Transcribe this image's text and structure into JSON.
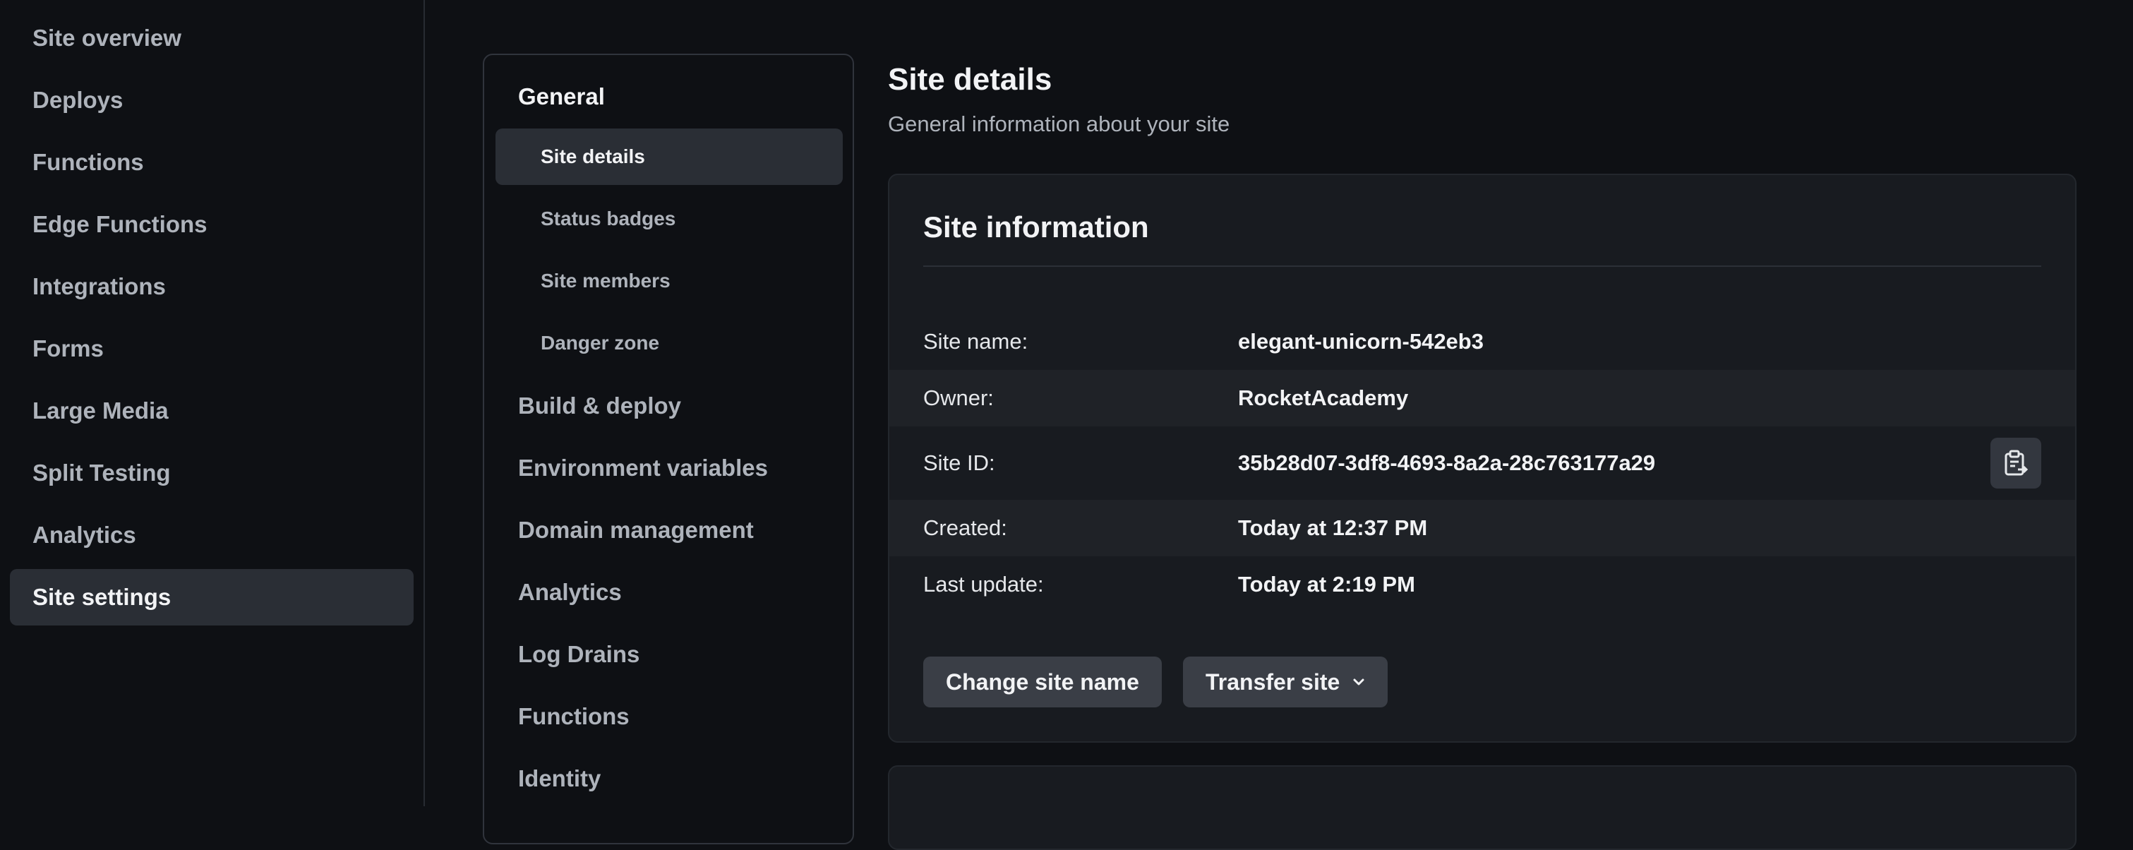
{
  "leftnav": {
    "items": [
      {
        "label": "Site overview"
      },
      {
        "label": "Deploys"
      },
      {
        "label": "Functions"
      },
      {
        "label": "Edge Functions"
      },
      {
        "label": "Integrations"
      },
      {
        "label": "Forms"
      },
      {
        "label": "Large Media"
      },
      {
        "label": "Split Testing"
      },
      {
        "label": "Analytics"
      },
      {
        "label": "Site settings"
      }
    ]
  },
  "subnav": {
    "general": "General",
    "general_items": [
      {
        "label": "Site details"
      },
      {
        "label": "Status badges"
      },
      {
        "label": "Site members"
      },
      {
        "label": "Danger zone"
      }
    ],
    "groups": [
      {
        "label": "Build & deploy"
      },
      {
        "label": "Environment variables"
      },
      {
        "label": "Domain management"
      },
      {
        "label": "Analytics"
      },
      {
        "label": "Log Drains"
      },
      {
        "label": "Functions"
      },
      {
        "label": "Identity"
      }
    ]
  },
  "main": {
    "title": "Site details",
    "subtitle": "General information about your site",
    "card": {
      "title": "Site information",
      "rows": [
        {
          "label": "Site name:",
          "value": "elegant-unicorn-542eb3"
        },
        {
          "label": "Owner:",
          "value": "RocketAcademy"
        },
        {
          "label": "Site ID:",
          "value": "35b28d07-3df8-4693-8a2a-28c763177a29"
        },
        {
          "label": "Created:",
          "value": "Today at 12:37 PM"
        },
        {
          "label": "Last update:",
          "value": "Today at 2:19 PM"
        }
      ],
      "change_name_label": "Change site name",
      "transfer_label": "Transfer site"
    }
  },
  "icons": {
    "copy": "clipboard-copy-icon",
    "transfer_menu": "chevron-down-icon"
  }
}
